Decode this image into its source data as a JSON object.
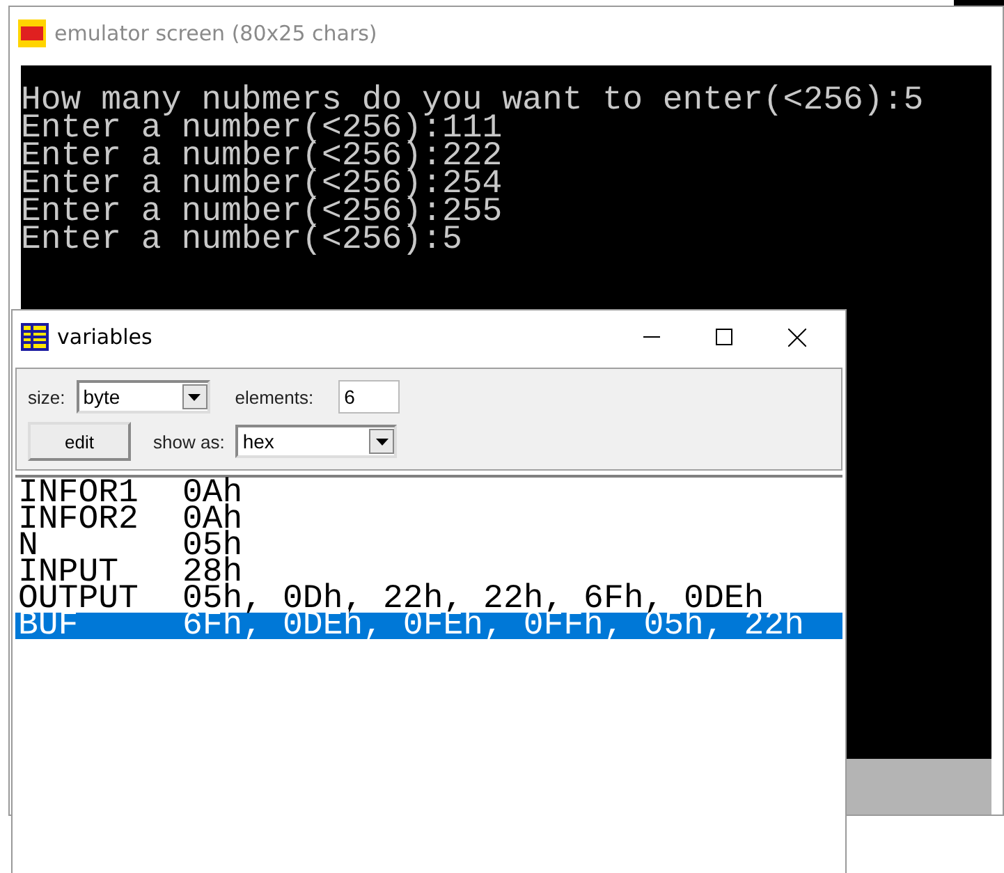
{
  "emulator_window": {
    "title": "emulator screen (80x25 chars)",
    "console_lines": [
      "How many nubmers do you want to enter(<256):5",
      "Enter a number(<256):111",
      "Enter a number(<256):222",
      "Enter a number(<256):254",
      "Enter a number(<256):255",
      "Enter a number(<256):5"
    ]
  },
  "variables_window": {
    "title": "variables",
    "size": {
      "label": "size:",
      "value": "byte"
    },
    "elements": {
      "label": "elements:",
      "value": "6"
    },
    "edit_button": "edit",
    "show_as": {
      "label": "show as:",
      "value": "hex"
    },
    "rows": [
      {
        "name": "INFOR1",
        "value": "0Ah",
        "selected": false
      },
      {
        "name": "INFOR2",
        "value": "0Ah",
        "selected": false
      },
      {
        "name": "N",
        "value": "05h",
        "selected": false
      },
      {
        "name": "INPUT",
        "value": "28h",
        "selected": false
      },
      {
        "name": "OUTPUT",
        "value": "05h, 0Dh, 22h, 22h, 6Fh, 0DEh",
        "selected": false
      },
      {
        "name": "BUF",
        "value": "6Fh, 0DEh, 0FEh, 0FFh, 05h, 22h",
        "selected": true
      }
    ]
  }
}
